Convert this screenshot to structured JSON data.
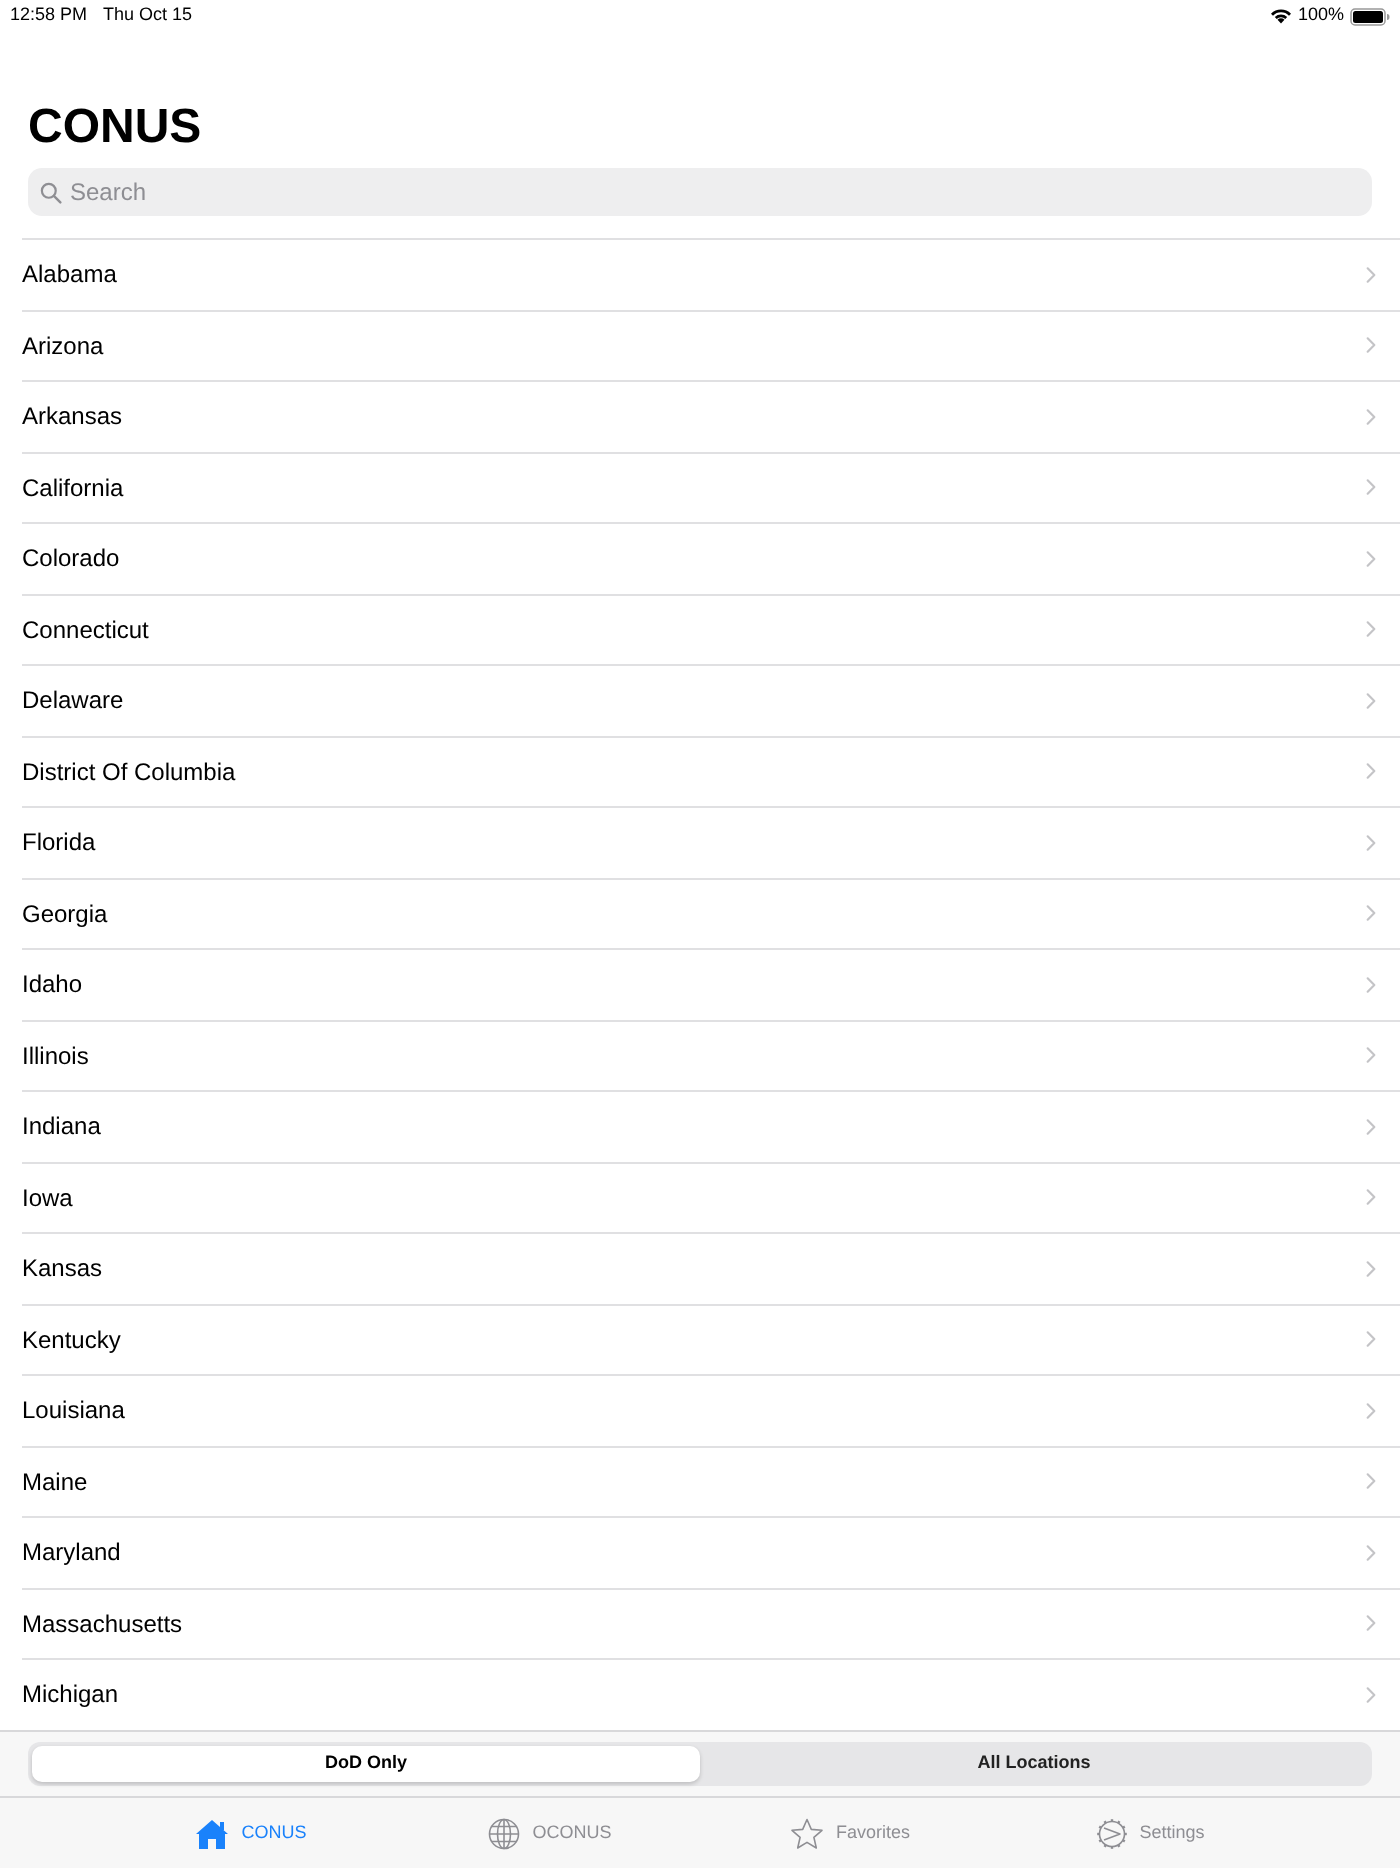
{
  "status_bar": {
    "time": "12:58 PM",
    "date": "Thu Oct 15",
    "battery": "100%"
  },
  "title": "CONUS",
  "search": {
    "placeholder": "Search"
  },
  "list": {
    "items": [
      {
        "label": "Alabama"
      },
      {
        "label": "Arizona"
      },
      {
        "label": "Arkansas"
      },
      {
        "label": "California"
      },
      {
        "label": "Colorado"
      },
      {
        "label": "Connecticut"
      },
      {
        "label": "Delaware"
      },
      {
        "label": "District Of Columbia"
      },
      {
        "label": "Florida"
      },
      {
        "label": "Georgia"
      },
      {
        "label": "Idaho"
      },
      {
        "label": "Illinois"
      },
      {
        "label": "Indiana"
      },
      {
        "label": "Iowa"
      },
      {
        "label": "Kansas"
      },
      {
        "label": "Kentucky"
      },
      {
        "label": "Louisiana"
      },
      {
        "label": "Maine"
      },
      {
        "label": "Maryland"
      },
      {
        "label": "Massachusetts"
      },
      {
        "label": "Michigan"
      }
    ]
  },
  "filter": {
    "segments": [
      {
        "label": "DoD Only",
        "selected": true
      },
      {
        "label": "All Locations",
        "selected": false
      }
    ]
  },
  "tab_bar": {
    "tabs": [
      {
        "label": "CONUS",
        "selected": true
      },
      {
        "label": "OCONUS",
        "selected": false
      },
      {
        "label": "Favorites",
        "selected": false
      },
      {
        "label": "Settings",
        "selected": false
      }
    ]
  }
}
